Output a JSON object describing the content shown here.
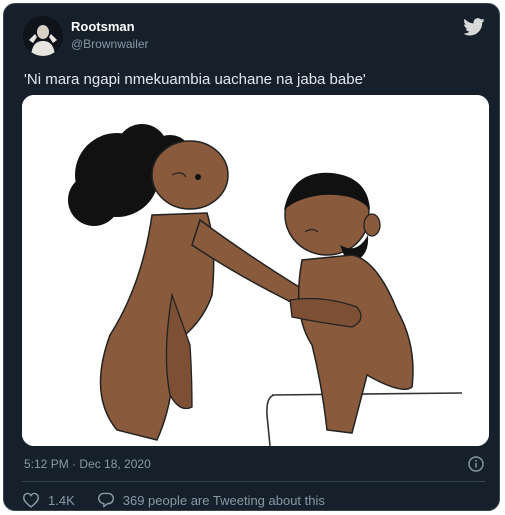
{
  "user": {
    "display_name": "Rootsman",
    "handle": "@Brownwailer"
  },
  "tweet": {
    "text": "'Ni mara ngapi nmekuambia uachane na jaba babe'",
    "timestamp": "5:12 PM · Dec 18, 2020"
  },
  "stats": {
    "likes": "1.4K",
    "tweeting_about": "369 people are Tweeting about this"
  },
  "icons": {
    "brand": "twitter-bird-icon",
    "info": "info-icon",
    "like": "heart-icon",
    "reply": "speech-bubble-icon"
  },
  "colors": {
    "card_background": "#15202b",
    "border": "#38444d",
    "secondary_text": "#8899a6",
    "primary_text": "#e1e8ed"
  }
}
